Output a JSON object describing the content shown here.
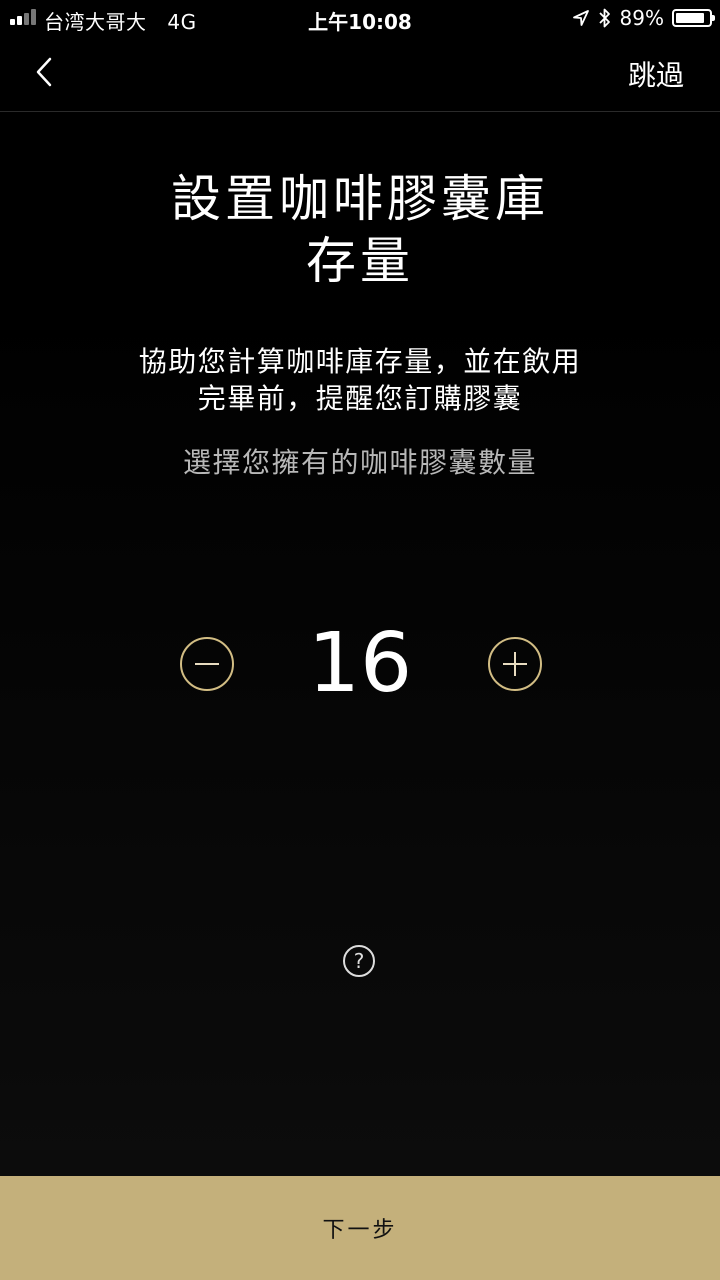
{
  "status_bar": {
    "carrier": "台湾大哥大",
    "network": "4G",
    "time": "上午10:08",
    "battery_percent": "89%",
    "battery_level": 0.89,
    "icons": [
      "signal-icon",
      "location-arrow-icon",
      "bluetooth-icon",
      "battery-icon"
    ]
  },
  "nav": {
    "back_icon": "chevron-left-icon",
    "skip_label": "跳過"
  },
  "content": {
    "title_line1": "設置咖啡膠囊庫",
    "title_line2": "存量",
    "description_line1": "協助您計算咖啡庫存量，並在飲用",
    "description_line2": "完畢前，提醒您訂購膠囊",
    "prompt": "選擇您擁有的咖啡膠囊數量"
  },
  "stepper": {
    "value": "16",
    "minus_icon": "minus-icon",
    "plus_icon": "plus-icon"
  },
  "help": {
    "icon": "question-mark-icon",
    "symbol": "?"
  },
  "footer": {
    "next_label": "下一步"
  },
  "colors": {
    "accent_gold": "#c4b07b",
    "stepper_ring": "#d2bd84",
    "background": "#000000"
  }
}
